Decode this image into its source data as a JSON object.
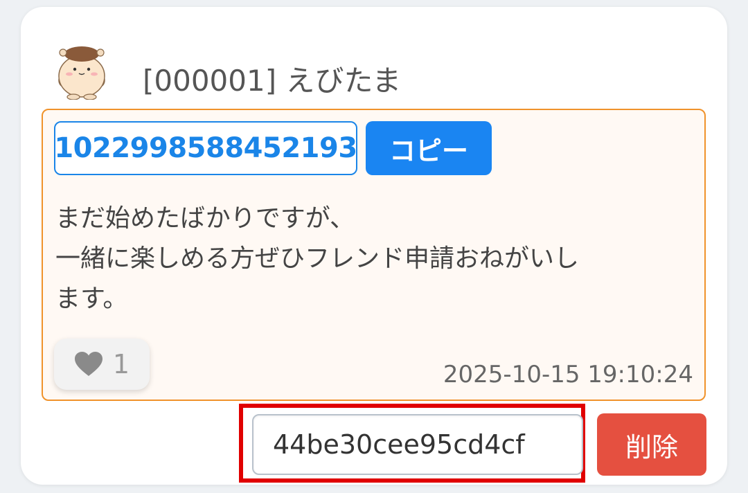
{
  "post": {
    "user_name": "[000001] えびたま",
    "friend_id": "1022998588452193",
    "copy_label": "コピー",
    "message_lines": [
      "まだ始めたばかりですが、",
      "一緒に楽しめる方ぜひフレンド申請おねがいし",
      "ます。"
    ],
    "like_count": "1",
    "timestamp": "2025-10-15 19:10:24"
  },
  "delete_form": {
    "input_value": "44be30cee95cd4cf",
    "delete_label": "削除"
  },
  "icons": {
    "avatar": "hamster-character-avatar",
    "like": "heart-icon"
  },
  "colors": {
    "accent_blue": "#1a85f2",
    "post_border": "#f0922a",
    "delete_red": "#e55040",
    "highlight_red": "#e00000"
  }
}
